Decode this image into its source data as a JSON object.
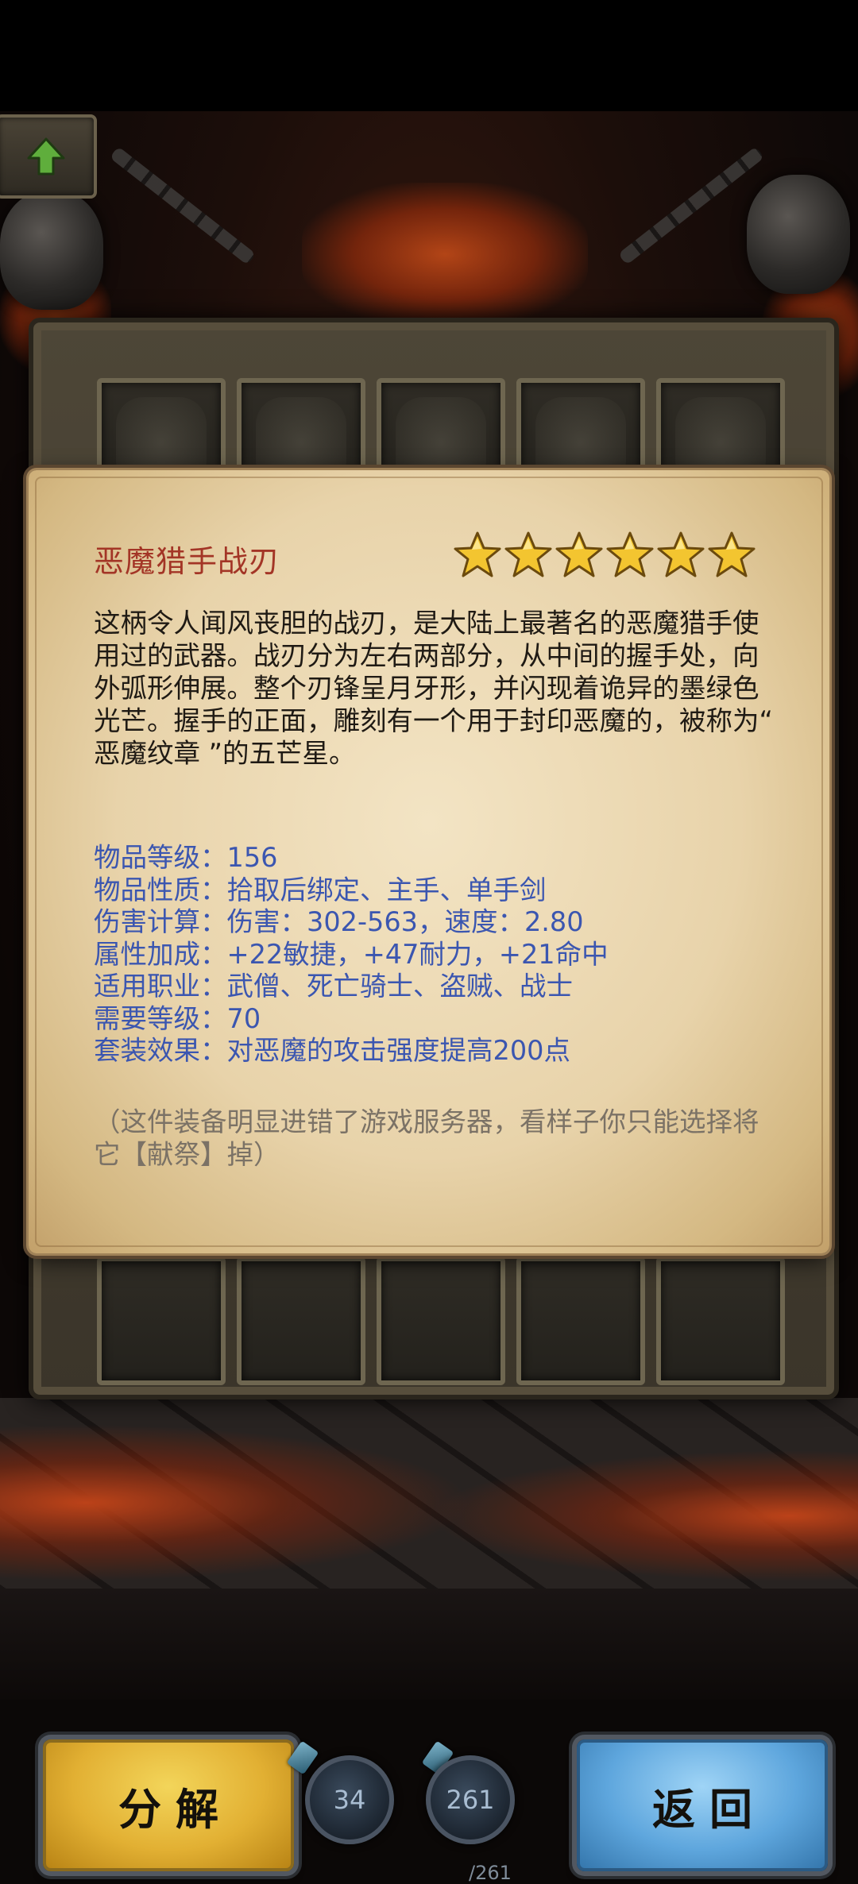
{
  "item": {
    "name": "恶魔猎手战刃",
    "stars": 6,
    "star_color": "#f3c530",
    "description": "这柄令人闻风丧胆的战刃，是大陆上最著名的恶魔猎手使用过的武器。战刃分为左右两部分，从中间的握手处，向外弧形伸展。整个刃锋呈月牙形，并闪现着诡异的墨绿色光芒。握手的正面，雕刻有一个用于封印恶魔的，被称为“ 恶魔纹章 ”的五芒星。",
    "stats": [
      {
        "label": "物品等级：",
        "value": "156"
      },
      {
        "label": "物品性质：",
        "value": "拾取后绑定、主手、单手剑"
      },
      {
        "label": "伤害计算：",
        "value": "伤害：302-563，速度：2.80"
      },
      {
        "label": "属性加成：",
        "value": "+22敏捷，+47耐力，+21命中"
      },
      {
        "label": "适用职业：",
        "value": "武僧、死亡骑士、盗贼、战士"
      },
      {
        "label": "需要等级：",
        "value": "70"
      },
      {
        "label": "套装效果：",
        "value": "对恶魔的攻击强度提高200点"
      }
    ],
    "note": "（这件装备明显进错了游戏服务器，看样子你只能选择将它【献祭】掉）"
  },
  "buttons": {
    "disassemble_label": "分解",
    "back_label": "返回"
  },
  "counters": {
    "left_value": "34",
    "right_value": "261",
    "right_max": "/261"
  },
  "icons": {
    "up": "up-arrow-icon",
    "star": "star-icon"
  },
  "colors": {
    "title": "#a33526",
    "stat_text": "#3b56b0",
    "note_text": "#7b7266",
    "disassemble_button": "#e2b033",
    "back_button": "#5ea6dd"
  }
}
